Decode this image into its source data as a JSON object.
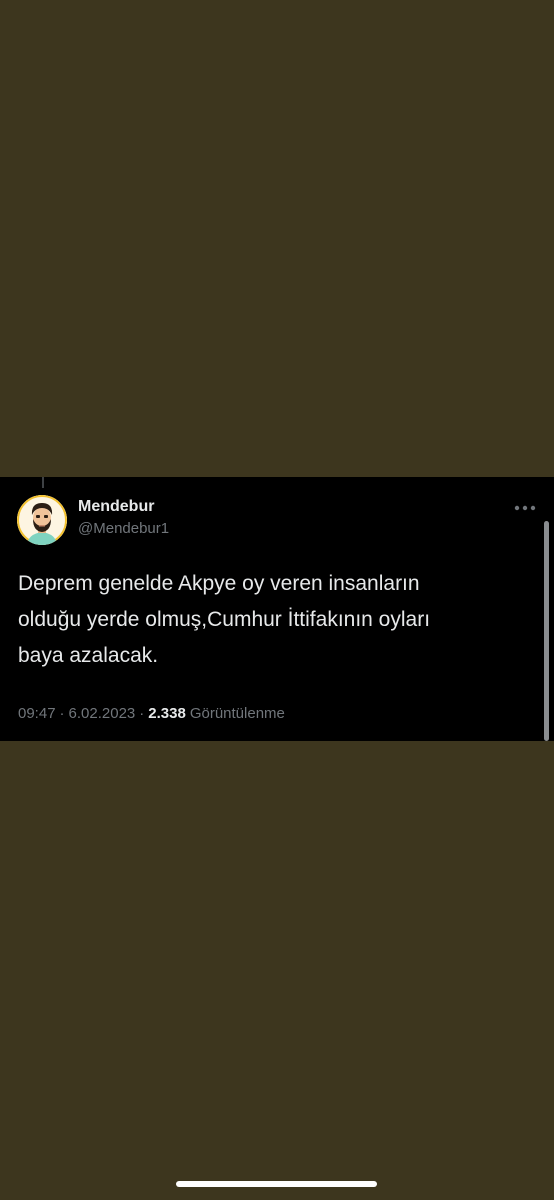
{
  "tweet": {
    "display_name": "Mendebur",
    "handle": "@Mendebur1",
    "avatar_icon": "cartoon-bearded-man-avatar",
    "more_icon": "more-horizontal-icon",
    "text": "Deprem genelde Akpye oy veren insanların\nolduğu yerde olmuş,Cumhur İttifakının oyları\nbaya azalacak.",
    "time": "09:47",
    "separator": "·",
    "date": "6.02.2023",
    "views_count": "2.338",
    "views_label": "Görüntülenme"
  },
  "colors": {
    "background": "#3d361e",
    "card_background": "#000000",
    "primary_text": "#e7e9ea",
    "secondary_text": "#71767b"
  }
}
